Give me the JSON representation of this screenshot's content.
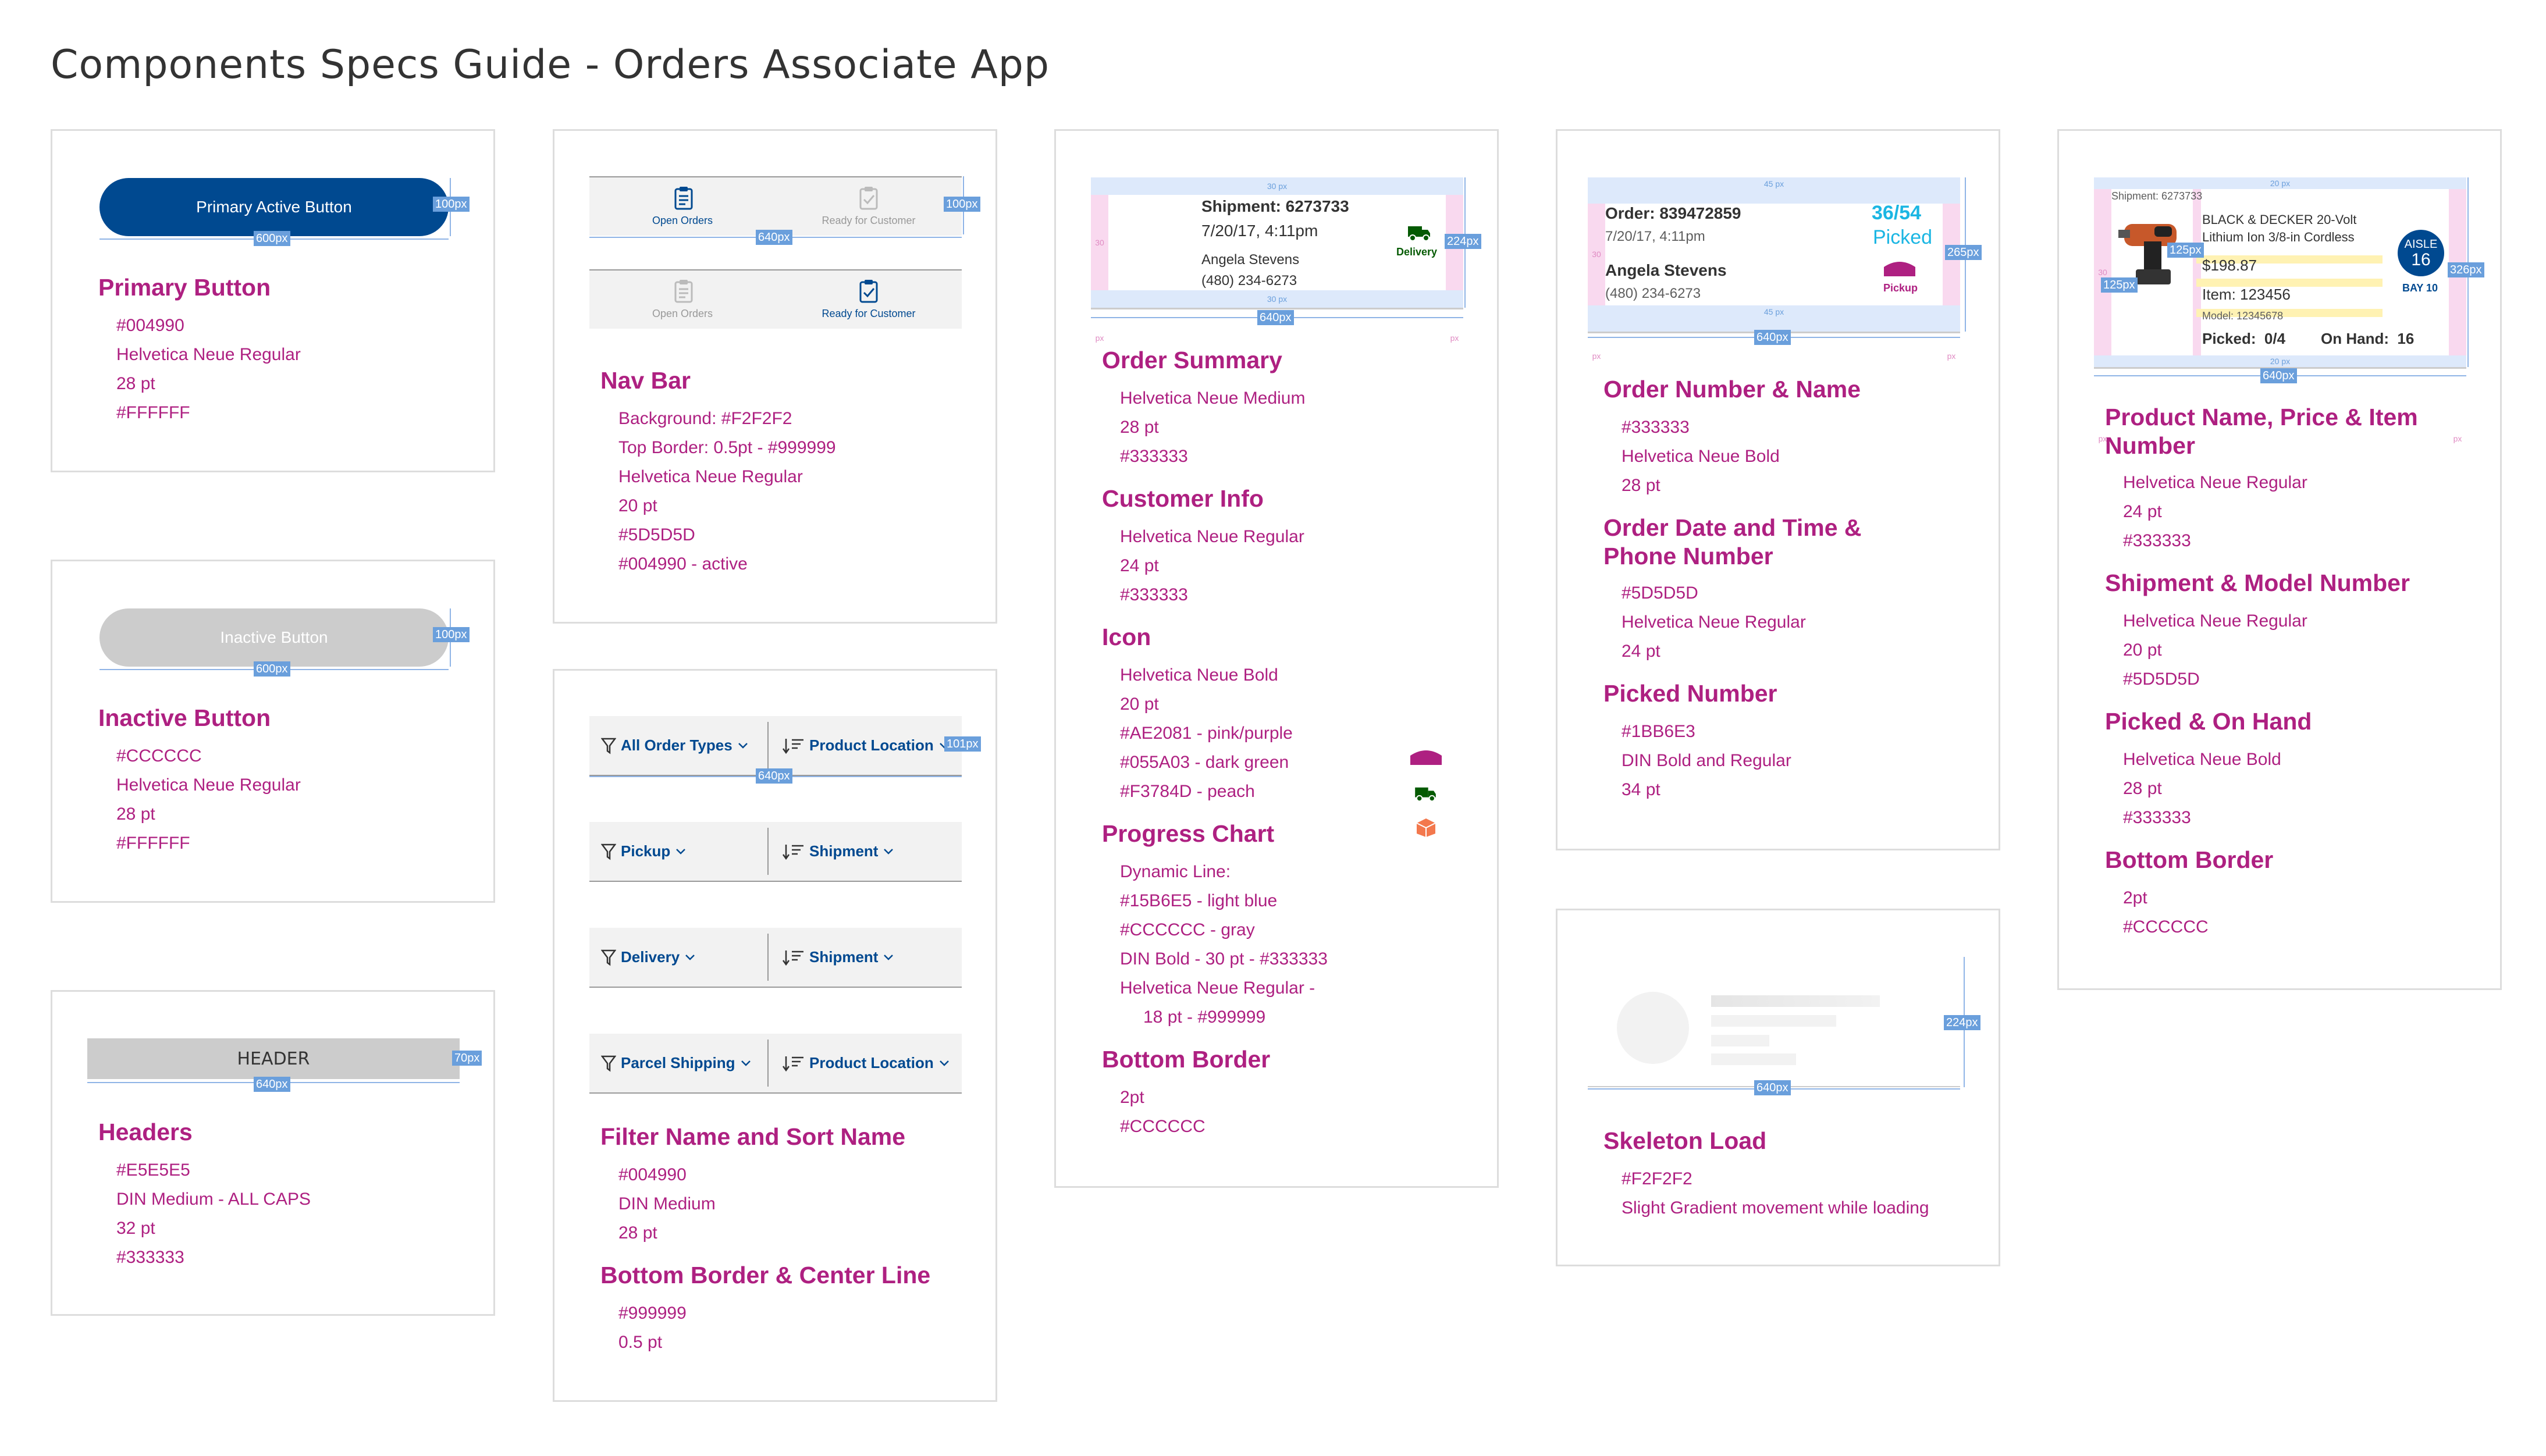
{
  "page": {
    "title": "Components Specs Guide - Orders Associate App"
  },
  "colors": {
    "primary": "#004990",
    "accent": "#AE2081",
    "green": "#055A03",
    "peach": "#F3784D",
    "lightblue": "#15B6E5",
    "gray": "#CCCCCC"
  },
  "dims": {
    "w600": "600px",
    "w640": "640px",
    "h100": "100px",
    "h70": "70px",
    "h101": "101px",
    "h224": "224px",
    "h265": "265px",
    "h326": "326px",
    "w125": "125px",
    "p30": "30 px",
    "p45": "45 px",
    "p20": "20 px",
    "p14": "14 px"
  },
  "primary_button": {
    "label": "Primary Active Button",
    "heading": "Primary Button",
    "specs": [
      "#004990",
      "Helvetica Neue Regular",
      "28 pt",
      "#FFFFFF"
    ]
  },
  "inactive_button": {
    "label": "Inactive Button",
    "heading": "Inactive Button",
    "specs": [
      "#CCCCCC",
      "Helvetica Neue Regular",
      "28 pt",
      "#FFFFFF"
    ]
  },
  "headers": {
    "label": "HEADER",
    "heading": "Headers",
    "specs": [
      "#E5E5E5",
      "DIN Medium - ALL CAPS",
      "32 pt",
      "#333333"
    ]
  },
  "nav_bar": {
    "tab_open": "Open Orders",
    "tab_ready": "Ready for Customer",
    "heading": "Nav Bar",
    "specs": [
      "Background: #F2F2F2",
      "Top Border: 0.5pt - #999999",
      "Helvetica Neue Regular",
      "20 pt",
      "#5D5D5D",
      "#004990 - active"
    ]
  },
  "filters": {
    "rows": [
      {
        "filter": "All Order Types",
        "sort": "Product Location"
      },
      {
        "filter": "Pickup",
        "sort": "Shipment"
      },
      {
        "filter": "Delivery",
        "sort": "Shipment"
      },
      {
        "filter": "Parcel Shipping",
        "sort": "Product Location"
      }
    ],
    "heading1": "Filter Name and Sort Name",
    "specs1": [
      "#004990",
      "DIN Medium",
      "28 pt"
    ],
    "heading2": "Bottom Border & Center Line",
    "specs2": [
      "#999999",
      "0.5 pt"
    ]
  },
  "order_card": {
    "shipment": "Shipment: 6273733",
    "datetime": "7/20/17, 4:11pm",
    "name": "Angela Stevens",
    "phone": "(480) 234-6273",
    "badge": "Delivery",
    "h1": "Order Summary",
    "s1": [
      "Helvetica Neue Medium",
      "28 pt",
      "#333333"
    ],
    "h2": "Customer Info",
    "s2": [
      "Helvetica Neue Regular",
      "24 pt",
      "#333333"
    ],
    "h3": "Icon",
    "s3": [
      "Helvetica Neue Bold",
      "20 pt",
      "#AE2081 - pink/purple",
      "#055A03 - dark green",
      "#F3784D - peach"
    ],
    "h4": "Progress Chart",
    "s4": [
      "Dynamic Line:",
      "#15B6E5 - light blue",
      "#CCCCCC - gray",
      "DIN Bold - 30 pt - #333333",
      "Helvetica Neue Regular -",
      "18 pt - #999999"
    ],
    "h5": "Bottom Border",
    "s5": [
      "2pt",
      "#CCCCCC"
    ]
  },
  "order_number": {
    "order": "Order: 839472859",
    "datetime": "7/20/17, 4:11pm",
    "name": "Angela Stevens",
    "phone": "(480) 234-6273",
    "count": "36/54",
    "picked": "Picked",
    "badge": "Pickup",
    "h1": "Order Number & Name",
    "s1": [
      "#333333",
      "Helvetica Neue Bold",
      "28 pt"
    ],
    "h2": "Order Date and Time & Phone Number",
    "s2": [
      "#5D5D5D",
      "Helvetica Neue Regular",
      "24 pt"
    ],
    "h3": "Picked Number",
    "s3": [
      "#1BB6E3",
      "DIN Bold and Regular",
      "34 pt"
    ]
  },
  "skeleton": {
    "heading": "Skeleton Load",
    "specs": [
      "#F2F2F2",
      "Slight Gradient movement while loading"
    ]
  },
  "product": {
    "shipment": "Shipment: 6273733",
    "name_line1": "BLACK & DECKER 20-Volt",
    "name_line2": "Lithium Ion 3/8-in Cordless",
    "price": "$198.87",
    "item": "Item: 123456",
    "model": "Model: 12345678",
    "picked": "Picked:  0/4",
    "onhand": "On Hand:  16",
    "aisle_label": "AISLE",
    "aisle_num": "16",
    "bay": "BAY 10",
    "h1": "Product Name, Price & Item Number",
    "s1": [
      "Helvetica Neue Regular",
      "24 pt",
      "#333333"
    ],
    "h2": "Shipment & Model Number",
    "s2": [
      "Helvetica Neue Regular",
      "20 pt",
      "#5D5D5D"
    ],
    "h3": "Picked & On Hand",
    "s3": [
      "Helvetica Neue Bold",
      "28 pt",
      "#333333"
    ],
    "h4": "Bottom Border",
    "s4": [
      "2pt",
      "#CCCCCC"
    ]
  }
}
